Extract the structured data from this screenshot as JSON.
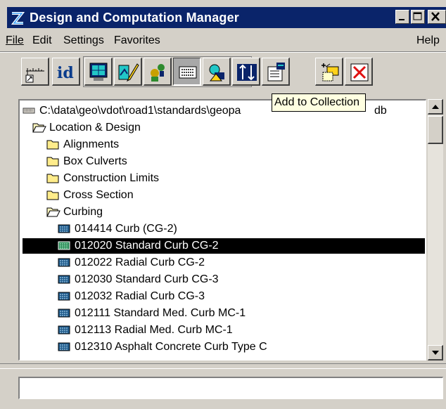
{
  "window": {
    "title": "Design and Computation Manager",
    "app_icon": "dcm-logo-icon",
    "controls": [
      "minimize-icon",
      "maximize-icon",
      "close-icon"
    ]
  },
  "menu": {
    "file": "File",
    "edit": "Edit",
    "settings": "Settings",
    "favorites": "Favorites",
    "help": "Help"
  },
  "toolbar": {
    "tooltip": "Add to Collection",
    "buttons": [
      "ruler-icon",
      "id-icon",
      "display-icon",
      "pencil-icon",
      "people-icon",
      "keypad-icon",
      "shapes-icon",
      "toggle-icon",
      "add-to-collection-icon",
      "new-item-icon",
      "delete-icon"
    ]
  },
  "tree": {
    "path": "C:\\data\\geo\\vdot\\road1\\standards\\geopa",
    "path_tail": "db",
    "root_folder": "Location & Design",
    "folders": [
      "Alignments",
      "Box Culverts",
      "Construction Limits",
      "Cross Section",
      "Curbing"
    ],
    "items": [
      "014414 Curb (CG-2)",
      "012020 Standard Curb CG-2",
      "012022 Radial Curb CG-2",
      "012030 Standard Curb CG-3",
      "012032 Radial Curb CG-3",
      "012111 Standard Med. Curb MC-1",
      "012113 Radial Med. Curb MC-1",
      "012310 Asphalt Concrete Curb Type C"
    ],
    "selected_item": "012020 Standard Curb CG-2"
  },
  "status": {
    "text": ""
  }
}
